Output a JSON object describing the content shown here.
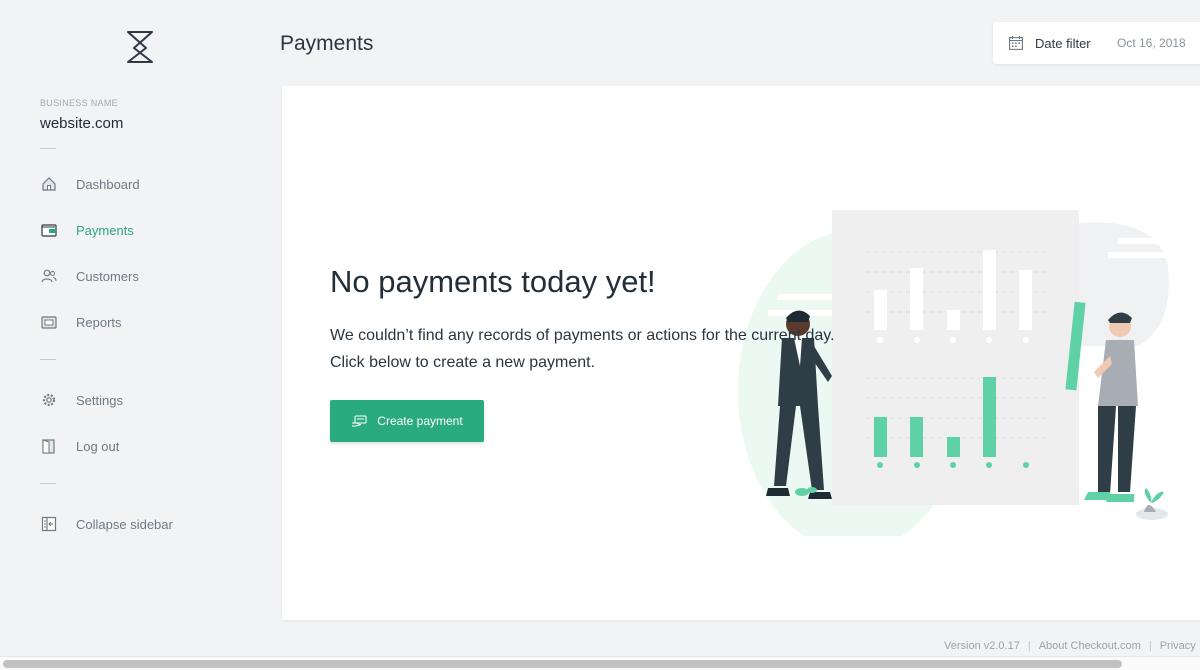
{
  "sidebar": {
    "business_label": "BUSINESS NAME",
    "business_name": "website.com",
    "items": [
      {
        "label": "Dashboard",
        "icon": "home-icon",
        "active": false
      },
      {
        "label": "Payments",
        "icon": "wallet-icon",
        "active": true
      },
      {
        "label": "Customers",
        "icon": "users-icon",
        "active": false
      },
      {
        "label": "Reports",
        "icon": "reports-icon",
        "active": false
      },
      {
        "label": "Settings",
        "icon": "gear-icon",
        "active": false
      },
      {
        "label": "Log out",
        "icon": "logout-door-icon",
        "active": false
      },
      {
        "label": "Collapse sidebar",
        "icon": "collapse-sidebar-icon",
        "active": false
      }
    ]
  },
  "header": {
    "title": "Payments",
    "date_filter": {
      "label": "Date filter",
      "value": "Oct 16, 2018"
    }
  },
  "empty_state": {
    "title": "No payments today yet!",
    "line1": "We couldn’t find any records of payments or actions for the current day.",
    "line2": "Click below to create a new payment.",
    "button_label": "Create payment"
  },
  "footer": {
    "version": "Version  v2.0.17",
    "about": "About Checkout.com",
    "privacy": "Privacy"
  },
  "colors": {
    "accent": "#2aab7f",
    "active_nav": "#2ca87f",
    "background": "#f2f3f5"
  }
}
